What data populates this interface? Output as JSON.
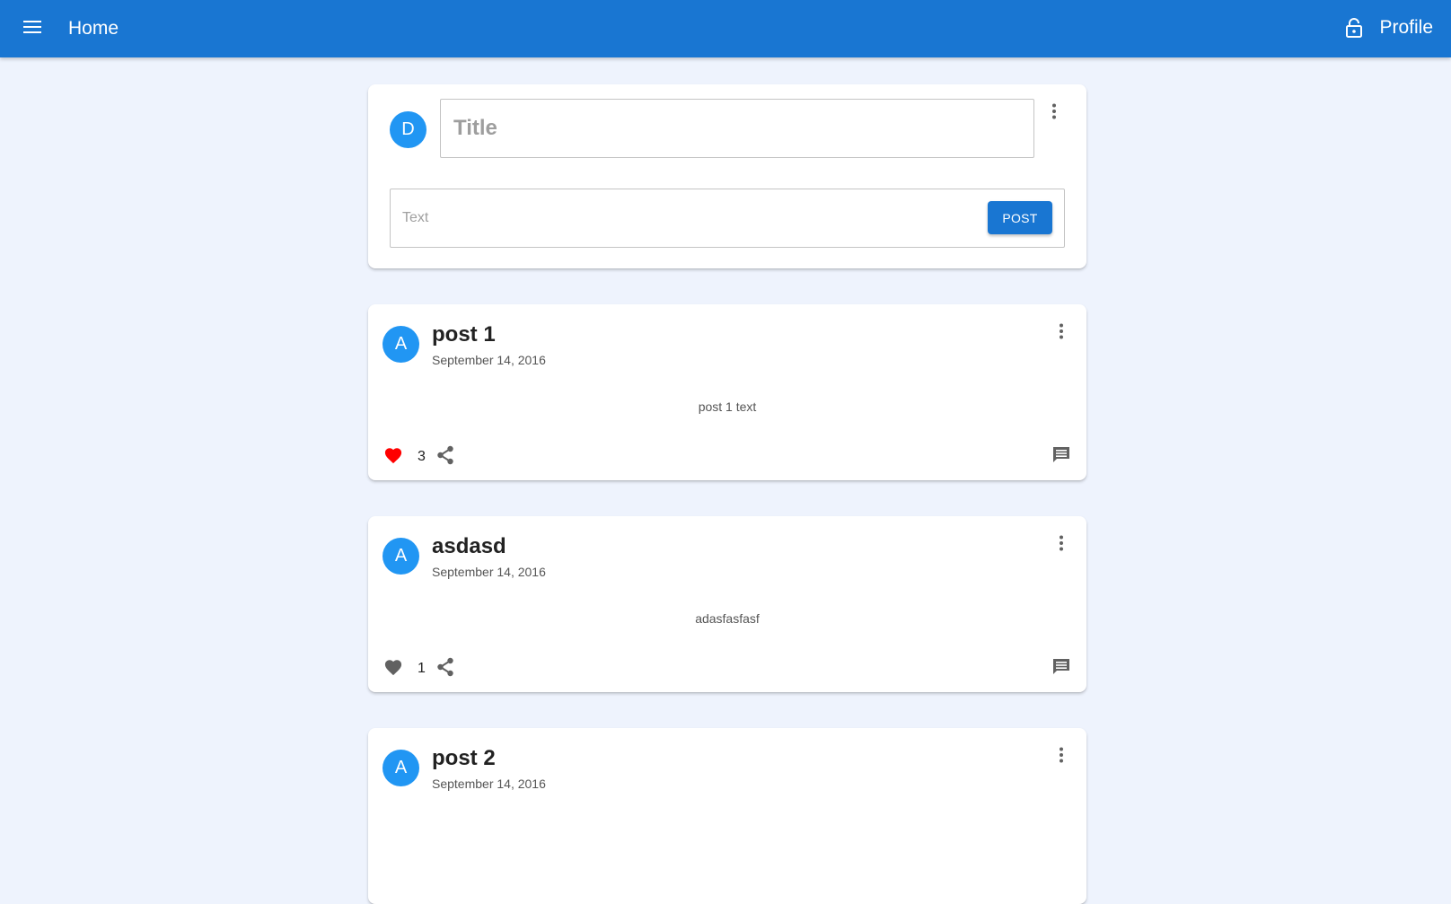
{
  "appbar": {
    "title": "Home",
    "profile_label": "Profile",
    "color": "#1976d2"
  },
  "composer": {
    "avatar_letter": "D",
    "title_placeholder": "Title",
    "title_value": "",
    "text_placeholder": "Text",
    "text_value": "",
    "post_label": "POST"
  },
  "posts": [
    {
      "avatar_letter": "A",
      "title": "post 1",
      "date": "September 14, 2016",
      "body": "post 1 text",
      "likes": "3",
      "liked": true
    },
    {
      "avatar_letter": "A",
      "title": "asdasd",
      "date": "September 14, 2016",
      "body": "adasfasfasf",
      "likes": "1",
      "liked": false
    },
    {
      "avatar_letter": "A",
      "title": "post 2",
      "date": "September 14, 2016"
    }
  ],
  "colors": {
    "liked": "#ff0000",
    "unliked": "#616161",
    "avatar": "#2196f3"
  },
  "icons": {
    "menu": "menu-icon",
    "lock": "lock-open-icon",
    "kebab": "more-vert-icon",
    "like": "heart-icon",
    "share": "share-icon",
    "comment": "comment-icon"
  }
}
